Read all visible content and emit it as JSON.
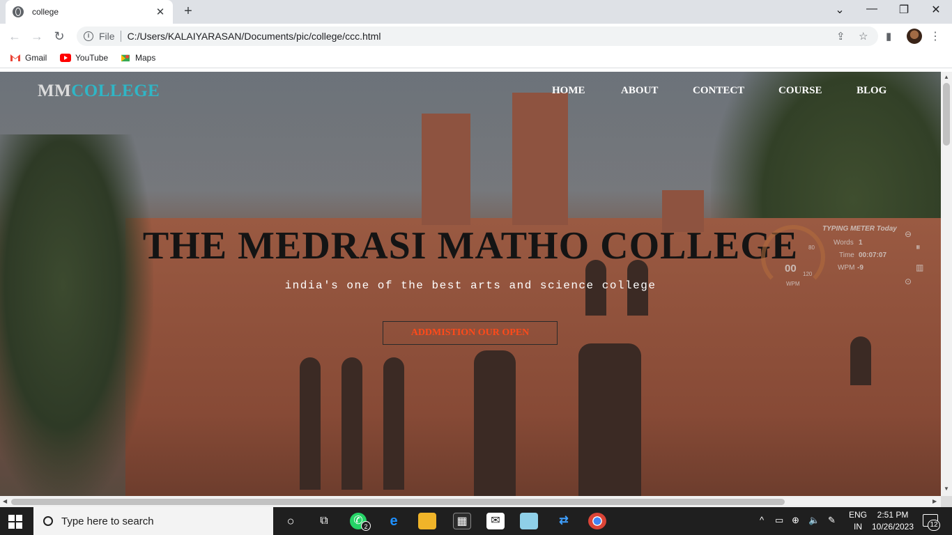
{
  "browser": {
    "tab_title": "college",
    "new_tab_icon": "+",
    "address": {
      "scheme_label": "File",
      "url": "C:/Users/KALAIYARASAN/Documents/pic/college/ccc.html"
    },
    "bookmarks": [
      {
        "label": "Gmail",
        "icon": "gmail-icon"
      },
      {
        "label": "YouTube",
        "icon": "youtube-icon"
      },
      {
        "label": "Maps",
        "icon": "maps-icon"
      }
    ]
  },
  "page": {
    "logo": {
      "part1": "MM",
      "part2": "COLLEGE"
    },
    "nav": [
      "HOME",
      "ABOUT",
      "CONTECT",
      "COURSE",
      "BLOG"
    ],
    "hero": {
      "title": "THE MEDRASI MATHO COLLEGE",
      "subtitle": "india's one of the best arts and science college",
      "cta": "ADDMISTION OUR OPEN"
    },
    "colors": {
      "logo_accent": "#2fb6c6",
      "cta_text": "#ff4a1a"
    }
  },
  "typing_meter": {
    "title": "TYPING METER Today",
    "words_label": "Words",
    "words_value": "1",
    "time_label": "Time",
    "time_value": "00:07:07",
    "wpm_label": "WPM",
    "wpm_value": "-9",
    "gauge_value": "00",
    "gauge_unit": "WPM",
    "gauge_ticks": [
      "80",
      "120"
    ]
  },
  "taskbar": {
    "search_placeholder": "Type here to search",
    "whatsapp_badge": "2",
    "language": {
      "line1": "ENG",
      "line2": "IN"
    },
    "time": "2:51 PM",
    "date": "10/26/2023",
    "notification_count": "12"
  }
}
